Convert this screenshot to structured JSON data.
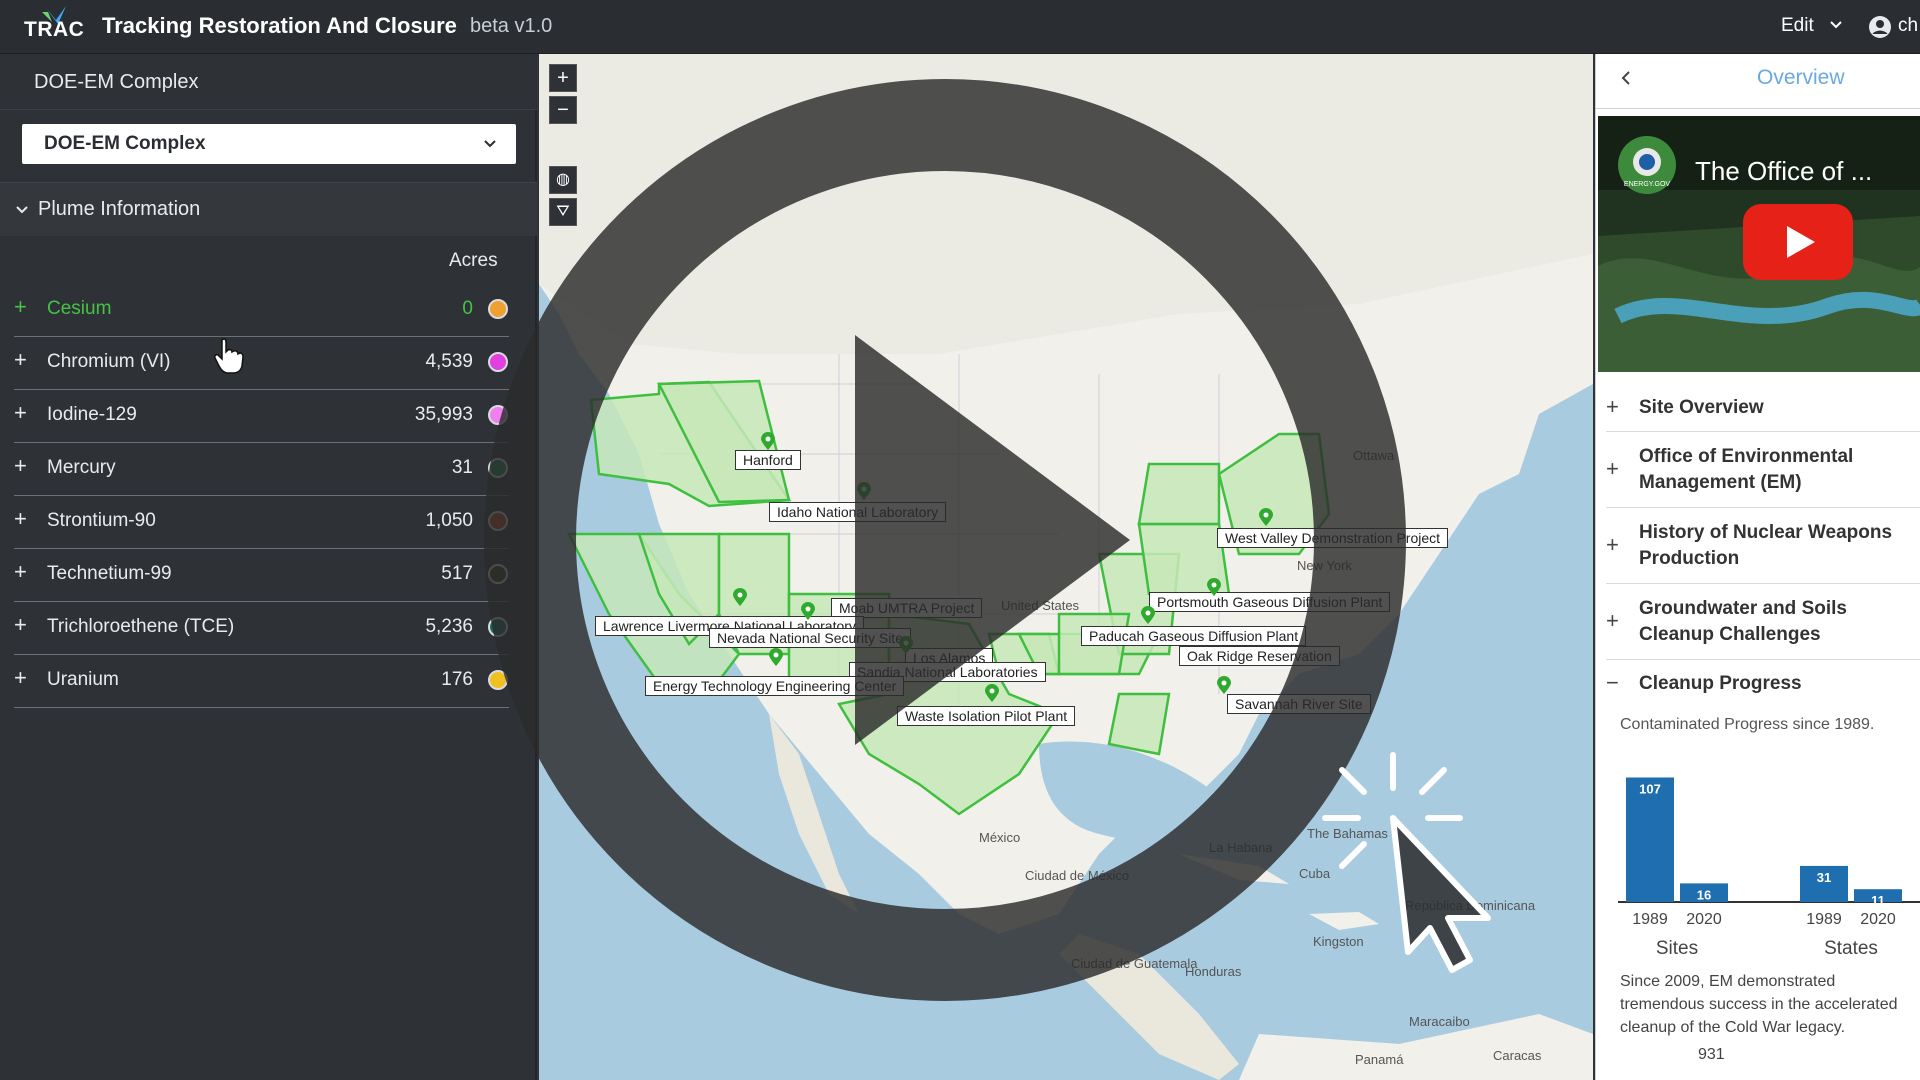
{
  "header": {
    "logo_text": "TRAC",
    "title": "Tracking Restoration And Closure",
    "version": "beta v1.0",
    "edit_menu": "Edit",
    "user_label": "ch"
  },
  "left_panel": {
    "section_title": "DOE-EM Complex",
    "complex_select_value": "DOE-EM Complex",
    "plume_header": "Plume Information",
    "acres_header": "Acres",
    "contaminants": [
      {
        "name": "Cesium",
        "acres": "0",
        "color": "#f0a030",
        "active": true
      },
      {
        "name": "Chromium (VI)",
        "acres": "4,539",
        "color": "#e040e0",
        "active": false
      },
      {
        "name": "Iodine-129",
        "acres": "35,993",
        "color": "#f080f0",
        "active": false
      },
      {
        "name": "Mercury",
        "acres": "31",
        "color": "#1a8a4a",
        "active": false
      },
      {
        "name": "Strontium-90",
        "acres": "1,050",
        "color": "#b04020",
        "active": false
      },
      {
        "name": "Technetium-99",
        "acres": "517",
        "color": "#3a3a20",
        "active": false
      },
      {
        "name": "Trichloroethene (TCE)",
        "acres": "5,236",
        "color": "#1a6a5a",
        "active": false
      },
      {
        "name": "Uranium",
        "acres": "176",
        "color": "#f0c020",
        "active": false
      }
    ]
  },
  "map": {
    "zoom_in": "+",
    "zoom_out": "−",
    "sites": [
      "Hanford",
      "Idaho National Laboratory",
      "West Valley Demonstration Project",
      "Moab UMTRA Project",
      "Portsmouth Gaseous Diffusion Plant",
      "Lawrence Livermore National Laboratory",
      "Nevada National Security Site",
      "Paducah Gaseous Diffusion Plant",
      "Los Alamos",
      "Oak Ridge Reservation",
      "Sandia National Laboratories",
      "Energy Technology Engineering Center",
      "Savannah River Site",
      "Waste Isolation Pilot Plant"
    ],
    "places": {
      "ottawa": "Ottawa",
      "new_york": "New York",
      "united_states": "United States",
      "mexico": "México",
      "ciudad_mexico": "Ciudad de México",
      "la_habana": "La Habana",
      "cuba": "Cuba",
      "bahamas": "The Bahamas",
      "kingston": "Kingston",
      "republica": "República Dominicana",
      "ciudad_guatemala": "Ciudad de Guatemala",
      "honduras": "Honduras",
      "maracaibo": "Maracaibo",
      "caracas": "Caracas",
      "panama": "Panamá"
    }
  },
  "right_panel": {
    "title": "Overview",
    "video_title": "The Office of ...",
    "video_channel": "ENERGY.GOV",
    "sections": [
      {
        "label": "Site Overview",
        "icon": "+"
      },
      {
        "label": "Office of Environmental Management (EM)",
        "icon": "+"
      },
      {
        "label": "History of Nuclear Weapons Production",
        "icon": "+"
      },
      {
        "label": "Groundwater and Soils Cleanup Challenges",
        "icon": "+"
      },
      {
        "label": "Cleanup Progress",
        "icon": "−"
      }
    ],
    "cleanup_subtitle": "Contaminated Progress since 1989.",
    "description": "Since 2009, EM demonstrated tremendous success in the accelerated cleanup of the Cold War legacy.",
    "count": "931"
  },
  "chart_data": {
    "type": "bar",
    "title": "",
    "groups": [
      {
        "name": "Sites",
        "categories": [
          "1989",
          "2020"
        ],
        "values": [
          107,
          16
        ]
      },
      {
        "name": "States",
        "categories": [
          "1989",
          "2020"
        ],
        "values": [
          31,
          11
        ]
      }
    ],
    "bar_color": "#1f6fb0",
    "ylim": [
      0,
      110
    ]
  },
  "colors": {
    "active_green": "#46c246",
    "site_green": "#2faa2f",
    "link_blue": "#6aa8e0"
  }
}
